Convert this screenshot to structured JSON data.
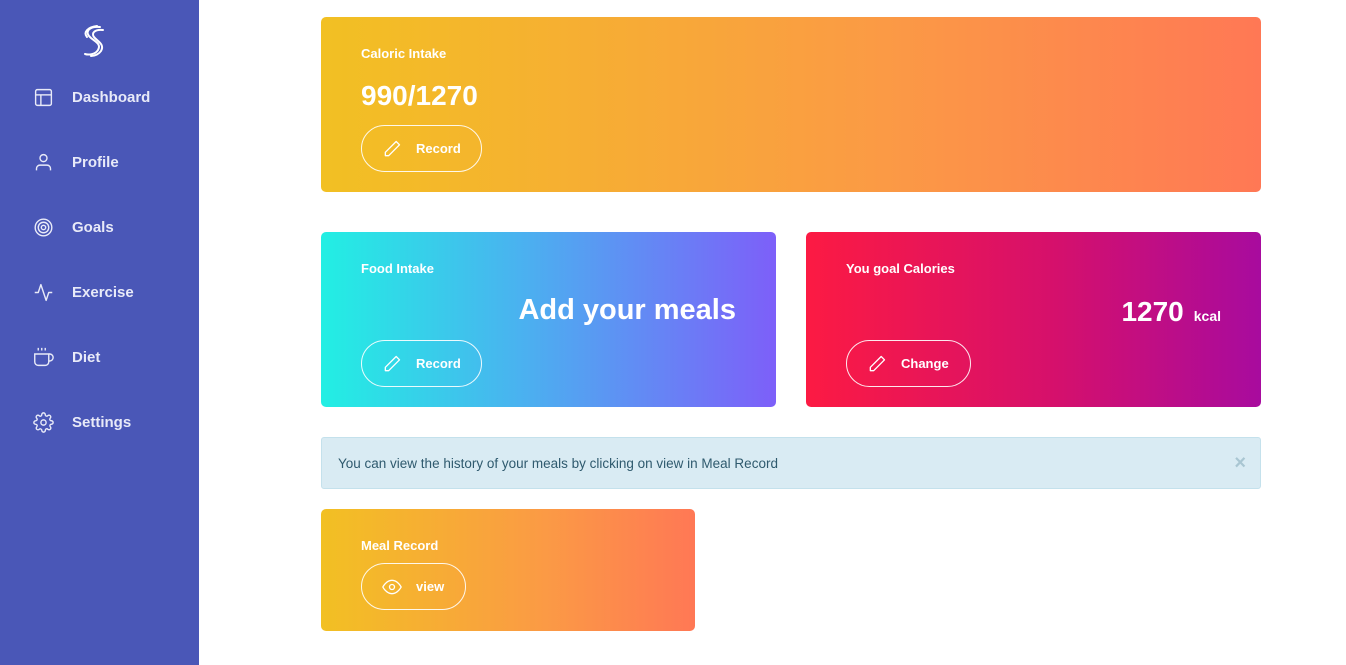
{
  "sidebar": {
    "logo_icon": "s-logo",
    "items": [
      {
        "label": "Dashboard",
        "icon": "layout-icon"
      },
      {
        "label": "Profile",
        "icon": "user-icon"
      },
      {
        "label": "Goals",
        "icon": "target-icon"
      },
      {
        "label": "Exercise",
        "icon": "activity-icon"
      },
      {
        "label": "Diet",
        "icon": "cup-icon"
      },
      {
        "label": "Settings",
        "icon": "gear-icon"
      }
    ]
  },
  "caloric": {
    "label": "Caloric Intake",
    "value": "990/1270",
    "button_label": "Record",
    "button_icon": "pencil-icon"
  },
  "food": {
    "label": "Food Intake",
    "headline": "Add your meals",
    "button_label": "Record",
    "button_icon": "pencil-icon"
  },
  "goal": {
    "label": "You goal Calories",
    "value": "1270",
    "unit": "kcal",
    "button_label": "Change",
    "button_icon": "pencil-icon"
  },
  "alert": {
    "text": "You can view the history of your meals by clicking on view in Meal Record",
    "close_symbol": "×"
  },
  "meal": {
    "label": "Meal Record",
    "button_label": "view",
    "button_icon": "eye-icon"
  },
  "colors": {
    "sidebar": "#4a57b7",
    "orange_gradient": [
      "#f2c023",
      "#ff7855"
    ],
    "cyan_gradient": [
      "#22efe3",
      "#7d5ff9"
    ],
    "magenta_gradient": [
      "#fc1a43",
      "#a80b9e"
    ],
    "alert_bg": "#d9ebf3"
  }
}
